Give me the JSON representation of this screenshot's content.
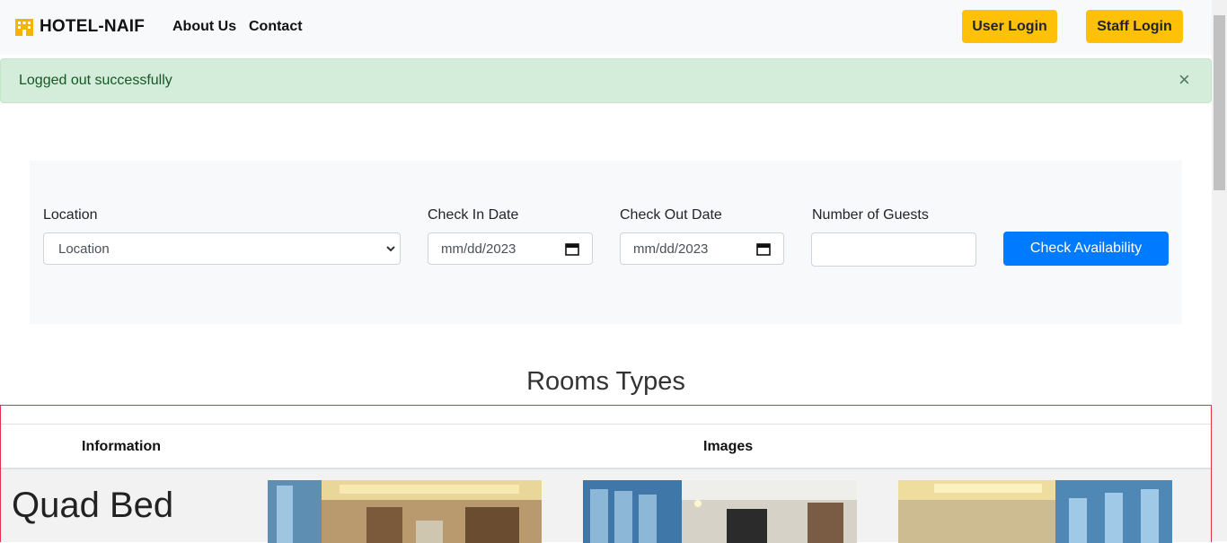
{
  "navbar": {
    "brand": "HOTEL-NAIF",
    "links": [
      "About Us",
      "Contact"
    ],
    "user_login": "User Login",
    "staff_login": "Staff Login"
  },
  "alert": {
    "message": "Logged out successfully",
    "close": "×"
  },
  "search": {
    "location_label": "Location",
    "location_value": "Location",
    "checkin_label": "Check In Date",
    "checkin_value": "mm/dd/2023",
    "checkout_label": "Check Out Date",
    "checkout_value": "mm/dd/2023",
    "guests_label": "Number of Guests",
    "guests_value": "",
    "submit": "Check Availability"
  },
  "rooms": {
    "title": "Rooms Types",
    "columns": [
      "Information",
      "Images"
    ],
    "rows": [
      {
        "name": "Quad Bed"
      }
    ]
  },
  "colors": {
    "accent_yellow": "#ffc107",
    "primary_blue": "#007bff",
    "alert_green": "#d4edda"
  }
}
